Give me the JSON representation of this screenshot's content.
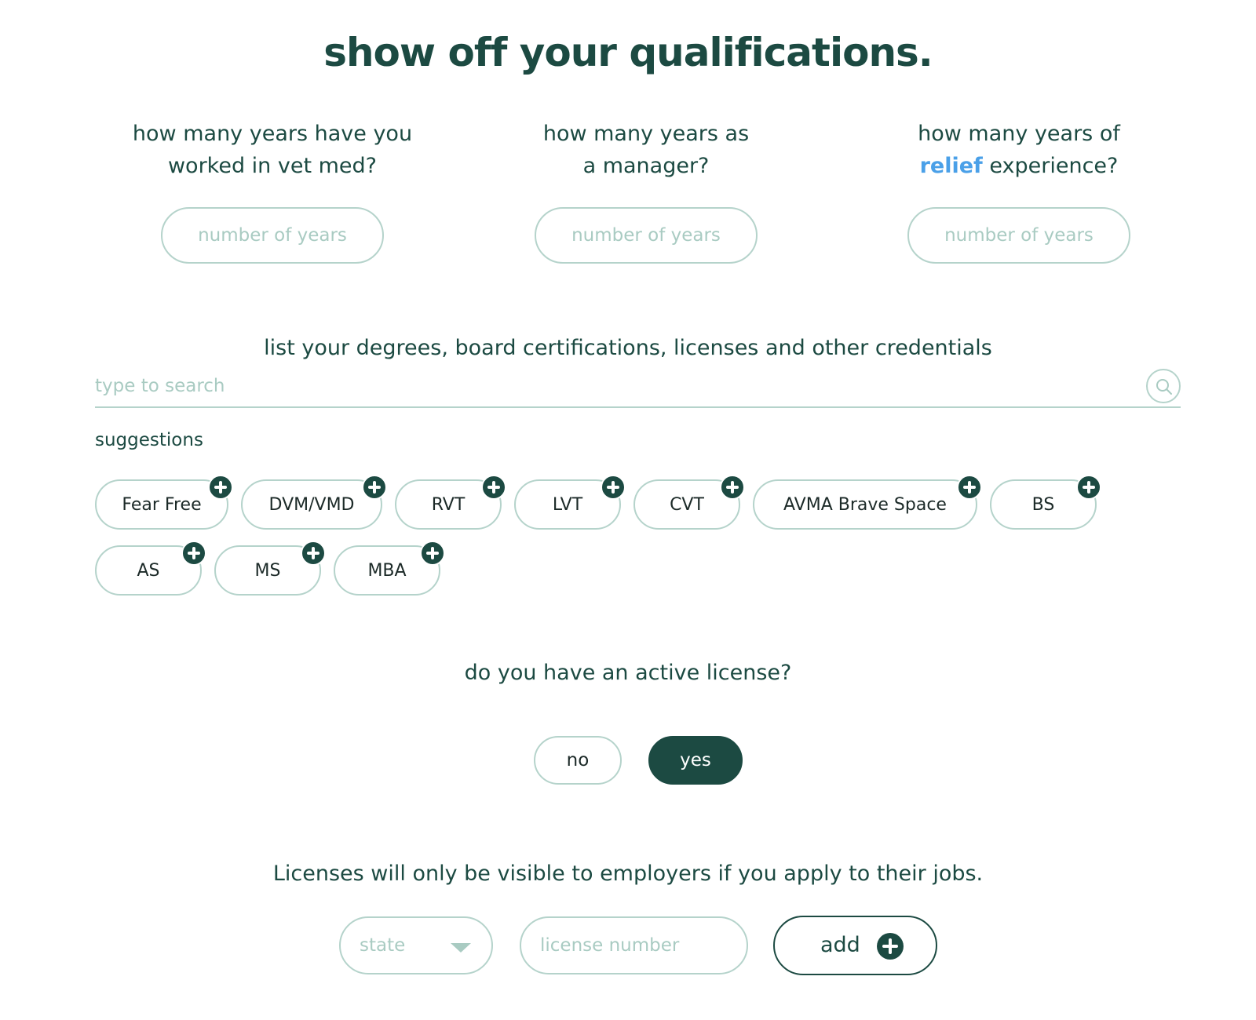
{
  "page": {
    "title": "show off your qualifications."
  },
  "experience": {
    "questions": [
      {
        "line1": "how many years have you",
        "line2": "worked in vet med?",
        "placeholder": "number of years",
        "value": ""
      },
      {
        "line1": "how many years as",
        "line2": "a manager?",
        "placeholder": "number of years",
        "value": ""
      },
      {
        "line1": "how many years of",
        "line2_highlight": "relief",
        "line2_rest": " experience?",
        "placeholder": "number of years",
        "value": ""
      }
    ]
  },
  "credentials": {
    "title": "list your degrees, board certifications, licenses and other credentials",
    "search_placeholder": "type to search",
    "search_value": "",
    "search_icon": "search-icon",
    "suggestions_label": "suggestions",
    "suggestions": [
      "Fear Free",
      "DVM/VMD",
      "RVT",
      "LVT",
      "CVT",
      "AVMA Brave Space",
      "BS",
      "AS",
      "MS",
      "MBA"
    ],
    "suggestion_add_icon": "plus-circle-icon"
  },
  "license": {
    "question": "do you have an active license?",
    "options": [
      {
        "label": "no",
        "selected": false
      },
      {
        "label": "yes",
        "selected": true
      }
    ],
    "note": "Licenses will only be visible to employers if you apply to their jobs.",
    "state_placeholder": "state",
    "state_icon": "chevron-down-icon",
    "license_number_placeholder": "license number",
    "license_number_value": "",
    "add_label": "add",
    "add_icon": "plus-circle-icon"
  },
  "colors": {
    "primary": "#1c4a42",
    "border": "#b5d3cb",
    "placeholder": "#a9cbc2",
    "highlight": "#4aa0e8",
    "background": "#ffffff"
  }
}
